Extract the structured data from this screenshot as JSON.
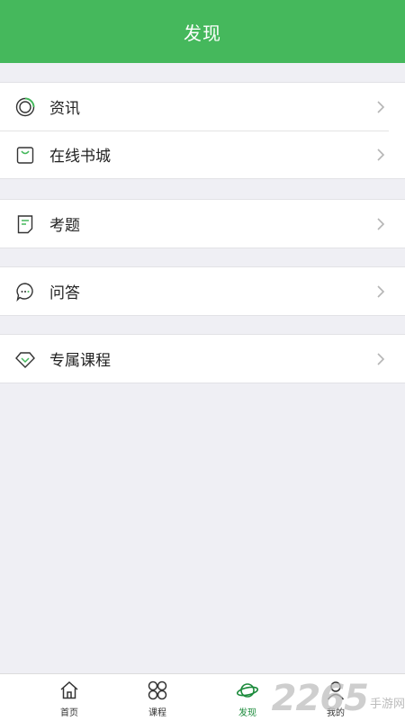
{
  "header": {
    "title": "发现"
  },
  "groups": [
    {
      "items": [
        {
          "label": "资讯",
          "icon": "news-ring-icon"
        },
        {
          "label": "在线书城",
          "icon": "shopping-bag-icon"
        }
      ]
    },
    {
      "items": [
        {
          "label": "考题",
          "icon": "document-icon"
        }
      ]
    },
    {
      "items": [
        {
          "label": "问答",
          "icon": "chat-bubble-icon"
        }
      ]
    },
    {
      "items": [
        {
          "label": "专属课程",
          "icon": "diamond-icon"
        }
      ]
    }
  ],
  "tabbar": {
    "tabs": [
      {
        "label": "首页",
        "icon": "home-icon",
        "active": false
      },
      {
        "label": "课程",
        "icon": "grid-icon",
        "active": false
      },
      {
        "label": "发现",
        "icon": "planet-icon",
        "active": true
      },
      {
        "label": "我的",
        "icon": "user-icon",
        "active": false
      }
    ]
  },
  "watermark": {
    "brand": "2265",
    "site": "手游网"
  },
  "colors": {
    "header": "#45b85c",
    "accent": "#1a8a3a",
    "background": "#efeff4"
  }
}
